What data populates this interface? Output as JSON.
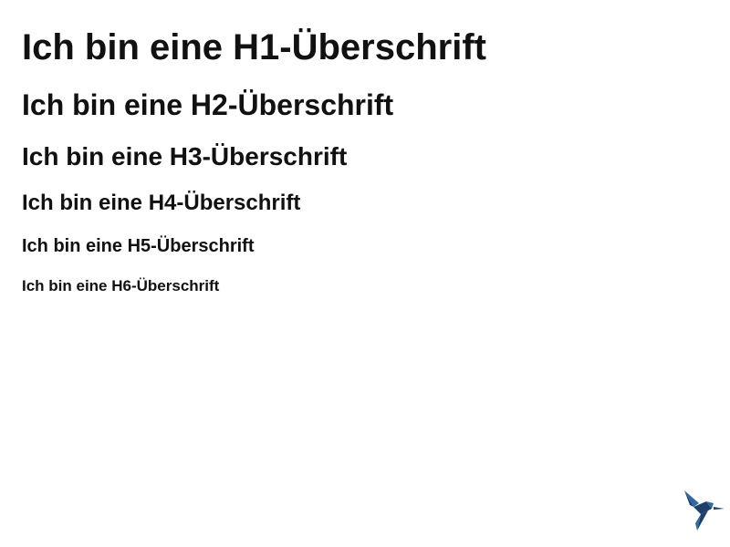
{
  "headings": {
    "h1": "Ich bin eine H1-Überschrift",
    "h2": "Ich bin eine H2-Überschrift",
    "h3": "Ich bin eine H3-Überschrift",
    "h4": "Ich bin eine H4-Überschrift",
    "h5": "Ich bin eine H5-Überschrift",
    "h6": "Ich bin eine H6-Überschrift"
  },
  "logo": {
    "icon": "hummingbird-logo-icon",
    "color_dark": "#1f3f6b",
    "color_light": "#2f6aa3"
  }
}
